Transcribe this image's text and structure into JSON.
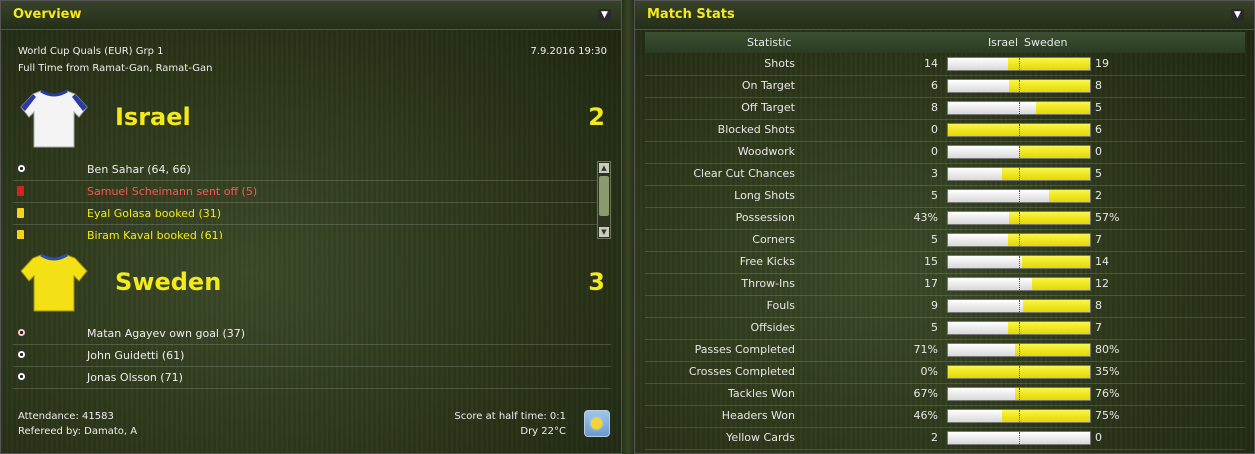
{
  "overview": {
    "title": "Overview",
    "competition": "World Cup Quals (EUR) Grp 1",
    "datetime": "7.9.2016 19:30",
    "venue": "Full Time from Ramat-Gan, Ramat-Gan",
    "home": {
      "name": "Israel",
      "score": "2",
      "events": [
        {
          "icon": "ball-icon",
          "text": "Ben Sahar (64, 66)",
          "color": "#eeeeee"
        },
        {
          "icon": "red-card-icon",
          "text": "Samuel Scheimann sent off (5)",
          "color": "#ff5555"
        },
        {
          "icon": "yellow-card-icon",
          "text": "Eyal Golasa booked (31)",
          "color": "#f2ea1c"
        },
        {
          "icon": "yellow-card-icon",
          "text": "Biram Kaval booked (61)",
          "color": "#f2ea1c"
        }
      ]
    },
    "away": {
      "name": "Sweden",
      "score": "3",
      "events": [
        {
          "icon": "own-goal-ball-icon",
          "text": "Matan Agayev own goal (37)",
          "color": "#eeeeee"
        },
        {
          "icon": "ball-icon",
          "text": "John Guidetti (61)",
          "color": "#eeeeee"
        },
        {
          "icon": "ball-icon",
          "text": "Jonas Olsson (71)",
          "color": "#eeeeee"
        }
      ]
    },
    "attendance": "Attendance: 41583",
    "referee": "Refereed by: Damato, A",
    "half_time": "Score at half time: 0:1",
    "weather": "Dry 22°C",
    "weather_icon": "sun-icon"
  },
  "stats": {
    "title": "Match Stats",
    "header_statistic": "Statistic",
    "header_home": "Israel",
    "header_away": "Sweden",
    "rows": [
      {
        "label": "Shots",
        "home": "14",
        "away": "19",
        "share": 0.42
      },
      {
        "label": "On Target",
        "home": "6",
        "away": "8",
        "share": 0.43
      },
      {
        "label": "Off Target",
        "home": "8",
        "away": "5",
        "share": 0.62
      },
      {
        "label": "Blocked Shots",
        "home": "0",
        "away": "6",
        "share": 0.0
      },
      {
        "label": "Woodwork",
        "home": "0",
        "away": "0",
        "share": 0.5
      },
      {
        "label": "Clear Cut Chances",
        "home": "3",
        "away": "5",
        "share": 0.38
      },
      {
        "label": "Long Shots",
        "home": "5",
        "away": "2",
        "share": 0.71
      },
      {
        "label": "Possession",
        "home": "43%",
        "away": "57%",
        "share": 0.43
      },
      {
        "label": "Corners",
        "home": "5",
        "away": "7",
        "share": 0.42
      },
      {
        "label": "Free Kicks",
        "home": "15",
        "away": "14",
        "share": 0.52
      },
      {
        "label": "Throw-Ins",
        "home": "17",
        "away": "12",
        "share": 0.59
      },
      {
        "label": "Fouls",
        "home": "9",
        "away": "8",
        "share": 0.53
      },
      {
        "label": "Offsides",
        "home": "5",
        "away": "7",
        "share": 0.42
      },
      {
        "label": "Passes Completed",
        "home": "71%",
        "away": "80%",
        "share": 0.47
      },
      {
        "label": "Crosses Completed",
        "home": "0%",
        "away": "35%",
        "share": 0.0
      },
      {
        "label": "Tackles Won",
        "home": "67%",
        "away": "76%",
        "share": 0.47
      },
      {
        "label": "Headers Won",
        "home": "46%",
        "away": "75%",
        "share": 0.38
      },
      {
        "label": "Yellow Cards",
        "home": "2",
        "away": "0",
        "share": 1.0
      }
    ]
  }
}
